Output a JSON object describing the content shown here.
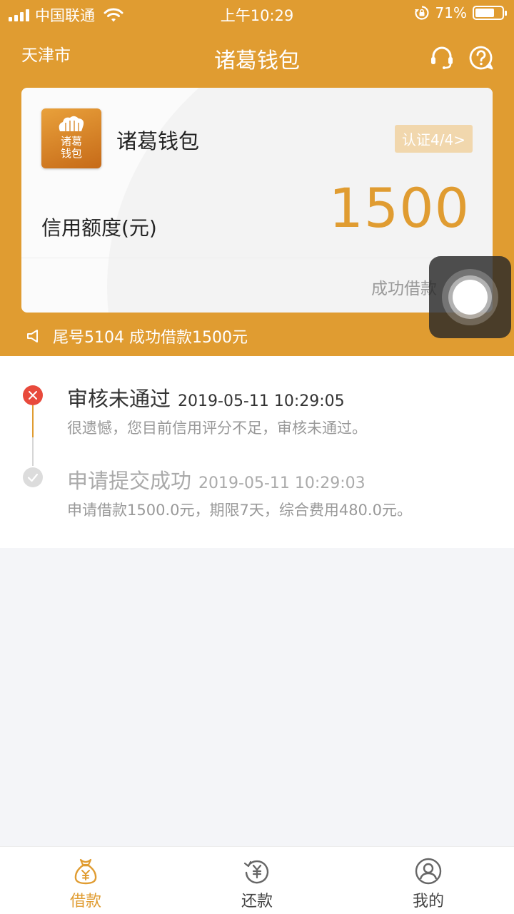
{
  "status_bar": {
    "carrier": "中国联通",
    "time": "上午10:29",
    "battery_percent": "71%",
    "battery_level": 0.71
  },
  "nav": {
    "city": "天津市",
    "title": "诸葛钱包",
    "icons": [
      "headset-icon",
      "help-icon"
    ]
  },
  "card": {
    "logo_text": "诸葛\n钱包",
    "name": "诸葛钱包",
    "cert_badge": "认证4/4>",
    "credit_label": "信用额度(元)",
    "credit_value": "1500",
    "success_link": "成功借款"
  },
  "notice": {
    "text": "尾号5104 成功借款1500元"
  },
  "timeline": [
    {
      "title": "审核未通过",
      "time": "2019-05-11 10:29:05",
      "desc": "很遗憾，您目前信用评分不足，审核未通过。",
      "status": "fail"
    },
    {
      "title": "申请提交成功",
      "time": "2019-05-11 10:29:03",
      "desc": "申请借款1500.0元，期限7天，综合费用480.0元。",
      "status": "done"
    }
  ],
  "tabs": [
    {
      "label": "借款",
      "icon": "money-bag-icon",
      "active": true
    },
    {
      "label": "还款",
      "icon": "repay-icon",
      "active": false
    },
    {
      "label": "我的",
      "icon": "profile-icon",
      "active": false
    }
  ],
  "colors": {
    "brand": "#e09c31",
    "fail": "#e84a3c",
    "badge_bg": "#f1d7ad"
  }
}
